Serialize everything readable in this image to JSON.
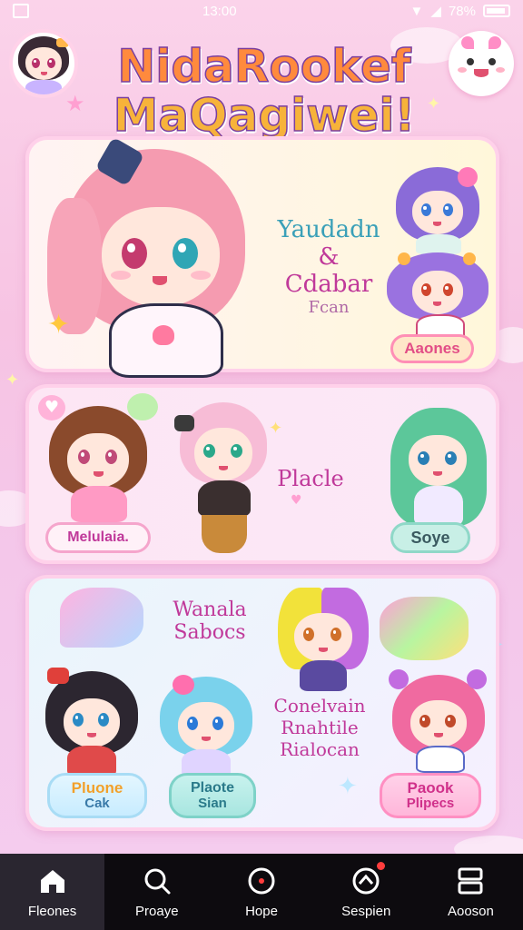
{
  "status_bar": {
    "time": "13:00",
    "battery": "78%"
  },
  "header": {
    "title_line1": "NidaRookef",
    "title_line2": "MaQagiwei!"
  },
  "panel1": {
    "text_line1": "Yaudadn",
    "text_line2": "&",
    "text_line3": "Cdabar",
    "text_line4": "Fcan",
    "button": "Aaones"
  },
  "panel2": {
    "caption": "Placle",
    "left_button": "Melulaia.",
    "right_button": "Soye"
  },
  "panel3": {
    "text_a_line1": "Wanala",
    "text_a_line2": "Sabocs",
    "text_b_line1": "Conelvain",
    "text_b_line2": "Rnahtile",
    "text_b_line3": "Rialocan",
    "btn1_line1": "Pluone",
    "btn1_line2": "Cak",
    "btn2_line1": "Plaote",
    "btn2_line2": "Sian",
    "btn3_line1": "Paook",
    "btn3_line2": "Plipecs"
  },
  "nav": [
    {
      "label": "Fleones",
      "icon": "home-icon"
    },
    {
      "label": "Proaye",
      "icon": "search-icon"
    },
    {
      "label": "Hope",
      "icon": "record-icon"
    },
    {
      "label": "Sespien",
      "icon": "bell-icon"
    },
    {
      "label": "Aooson",
      "icon": "panels-icon"
    }
  ],
  "colors": {
    "background": "#f7c4e3",
    "pink_text": "#c0399a",
    "teal_text": "#3aa0b8",
    "nav_bg": "#0d0b0f"
  }
}
